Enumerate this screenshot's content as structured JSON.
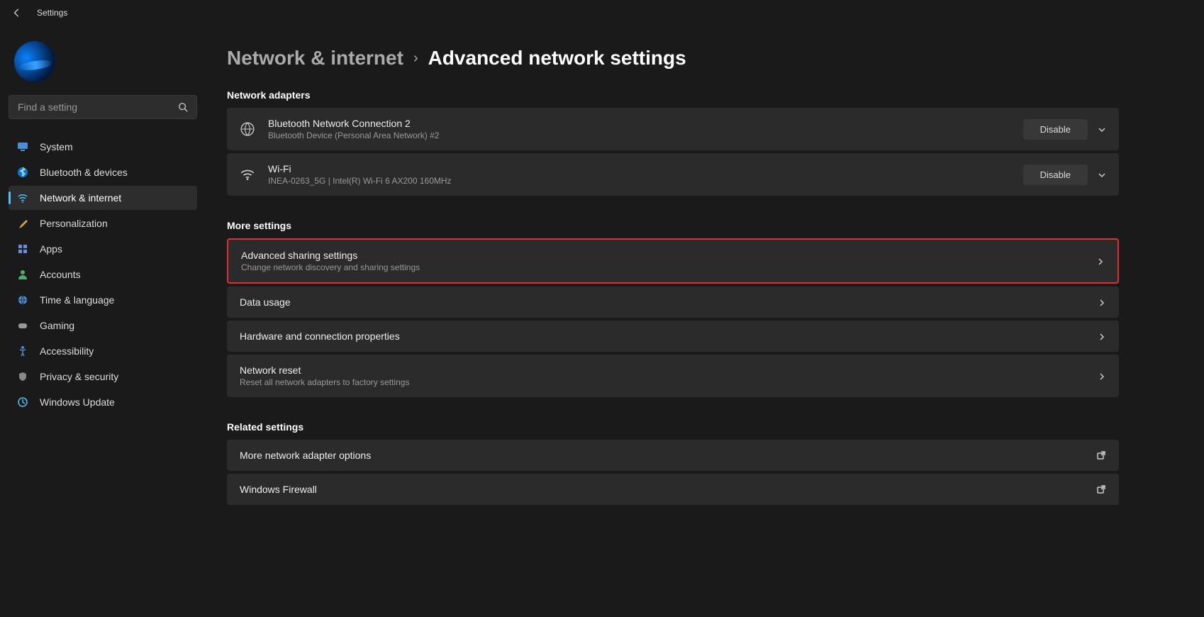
{
  "app": {
    "title": "Settings"
  },
  "search": {
    "placeholder": "Find a setting"
  },
  "nav": {
    "system": "System",
    "bluetooth": "Bluetooth & devices",
    "network": "Network & internet",
    "personalization": "Personalization",
    "apps": "Apps",
    "accounts": "Accounts",
    "time": "Time & language",
    "gaming": "Gaming",
    "accessibility": "Accessibility",
    "privacy": "Privacy & security",
    "update": "Windows Update"
  },
  "breadcrumb": {
    "parent": "Network & internet",
    "current": "Advanced network settings"
  },
  "sections": {
    "adapters": "Network adapters",
    "more": "More settings",
    "related": "Related settings"
  },
  "adapters": {
    "bt": {
      "title": "Bluetooth Network Connection 2",
      "sub": "Bluetooth Device (Personal Area Network) #2",
      "action": "Disable"
    },
    "wifi": {
      "title": "Wi-Fi",
      "sub": "INEA-0263_5G | Intel(R) Wi-Fi 6 AX200 160MHz",
      "action": "Disable"
    }
  },
  "more": {
    "sharing": {
      "title": "Advanced sharing settings",
      "sub": "Change network discovery and sharing settings"
    },
    "data": {
      "title": "Data usage"
    },
    "hardware": {
      "title": "Hardware and connection properties"
    },
    "reset": {
      "title": "Network reset",
      "sub": "Reset all network adapters to factory settings"
    }
  },
  "related": {
    "adapter": {
      "title": "More network adapter options"
    },
    "firewall": {
      "title": "Windows Firewall"
    }
  }
}
